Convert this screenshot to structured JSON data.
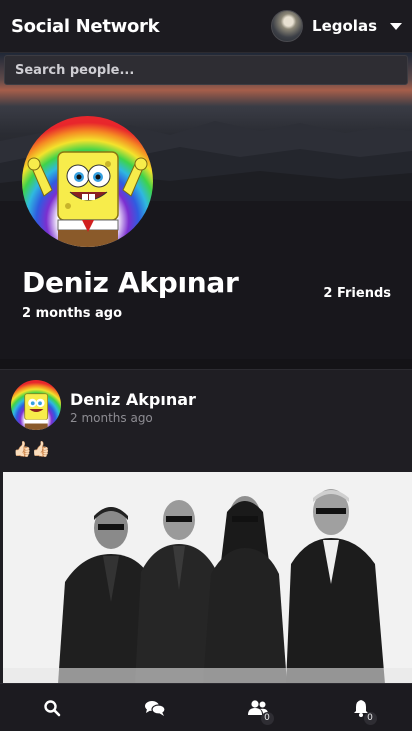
{
  "app": {
    "title": "Social Network"
  },
  "user_menu": {
    "name": "Legolas",
    "avatar_icon": "user-avatar-image"
  },
  "search": {
    "placeholder": "Search people..."
  },
  "profile": {
    "name": "Deniz Akpınar",
    "joined": "2 months ago",
    "friends": "2 Friends",
    "avatar_icon": "spongebob-rainbow-avatar"
  },
  "post": {
    "author": "Deniz Akpınar",
    "time": "2 months ago",
    "text": "👍🏻👍🏻",
    "image_icon": "band-photo-black-white"
  },
  "nav": {
    "items": [
      {
        "name": "search",
        "icon": "search-icon"
      },
      {
        "name": "messages",
        "icon": "chat-icon"
      },
      {
        "name": "friends",
        "icon": "users-icon",
        "badge": "0"
      },
      {
        "name": "notifications",
        "icon": "bell-icon",
        "badge": "0"
      }
    ]
  },
  "colors": {
    "background": "#18171c",
    "surface": "#1f1e23",
    "topbar": "#1c1b20",
    "text": "#ffffff",
    "muted": "#8d8c92"
  }
}
